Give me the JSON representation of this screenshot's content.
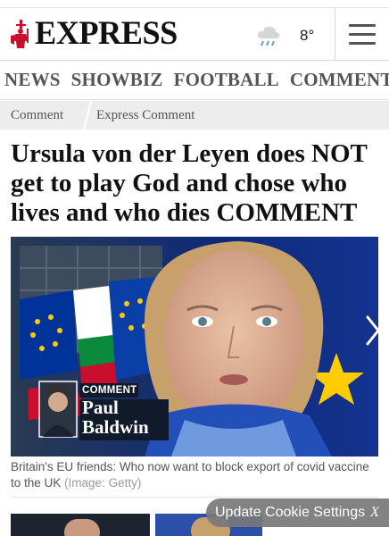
{
  "header": {
    "logo_text": "EXPRESS",
    "logo_icon": "crusader-knight-icon",
    "weather_icon": "cloud-rain-icon",
    "temperature": "8°",
    "menu_icon": "hamburger-menu-icon"
  },
  "nav": {
    "items": [
      {
        "label": "NEWS"
      },
      {
        "label": "SHOWBIZ"
      },
      {
        "label": "FOOTBALL"
      },
      {
        "label": "COMMENT"
      }
    ]
  },
  "breadcrumb": {
    "items": [
      {
        "label": "Comment"
      },
      {
        "label": "Express Comment"
      }
    ]
  },
  "article": {
    "headline": "Ursula von der Leyen does NOT get to play God and chose who lives and who dies COMMENT",
    "hero_badge": "COMMENT",
    "author_first": "Paul",
    "author_last": "Baldwin",
    "caption": "Britain's EU friends: Who now want to block export of covid vaccine to the UK",
    "credit": "(Image: Getty)"
  },
  "cookie": {
    "label": "Update Cookie Settings",
    "close": "X"
  },
  "colors": {
    "brand_red": "#c8102e",
    "eu_blue": "#003399",
    "eu_star": "#ffcc00",
    "nav_text": "#555555"
  }
}
